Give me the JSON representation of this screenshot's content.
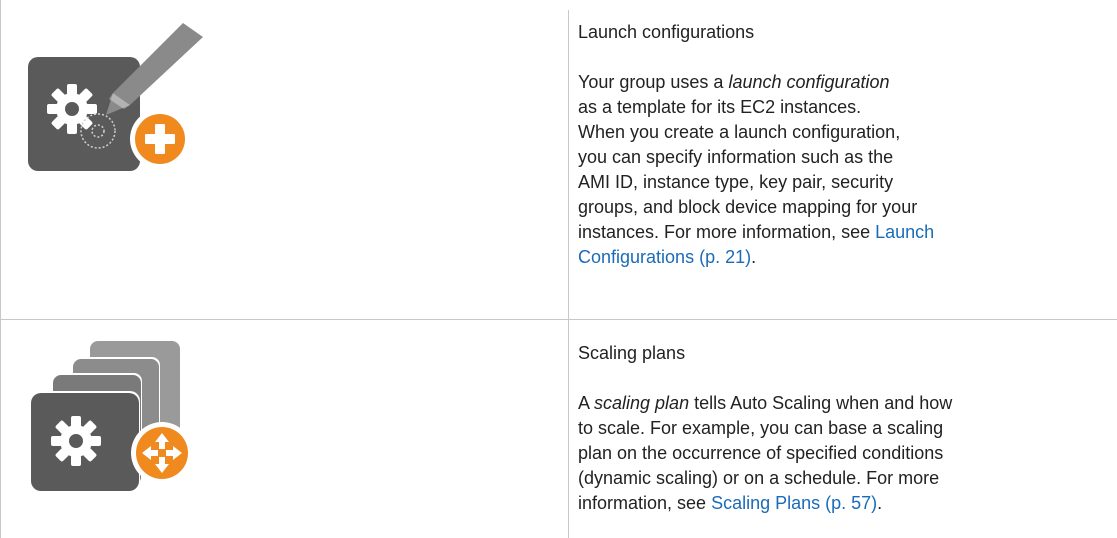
{
  "rows": [
    {
      "icon": "launch-configuration-icon",
      "title": "Launch configurations",
      "lines": [
        [
          {
            "text": "Your group uses a "
          },
          {
            "text": "launch configuration",
            "style": "italic"
          }
        ],
        [
          {
            "text": "as a template for its EC2 instances."
          }
        ],
        [
          {
            "text": "When you create a launch configuration,"
          }
        ],
        [
          {
            "text": "you can specify information such as the"
          }
        ],
        [
          {
            "text": "AMI ID, instance type, key pair, security"
          }
        ],
        [
          {
            "text": "groups, and block device mapping for your"
          }
        ],
        [
          {
            "text": "instances. For more information, see "
          },
          {
            "text": "Launch",
            "style": "link"
          }
        ],
        [
          {
            "text": "Configurations (p. 21)",
            "style": "link"
          },
          {
            "text": "."
          }
        ]
      ]
    },
    {
      "icon": "scaling-plan-icon",
      "title": "Scaling plans",
      "lines": [
        [
          {
            "text": "A "
          },
          {
            "text": "scaling plan",
            "style": "italic"
          },
          {
            "text": " tells Auto Scaling when and how"
          }
        ],
        [
          {
            "text": "to scale. For example, you can base a scaling"
          }
        ],
        [
          {
            "text": "plan on the occurrence of specified conditions"
          }
        ],
        [
          {
            "text": "(dynamic scaling) or on a schedule. For more"
          }
        ],
        [
          {
            "text": "information, see "
          },
          {
            "text": "Scaling Plans (p. 57)",
            "style": "link"
          },
          {
            "text": "."
          }
        ]
      ]
    }
  ],
  "colors": {
    "icon_dark": "#5a5a5a",
    "icon_orange": "#f08a1e",
    "link": "#1a6bb8",
    "border": "#c8c8c8"
  }
}
